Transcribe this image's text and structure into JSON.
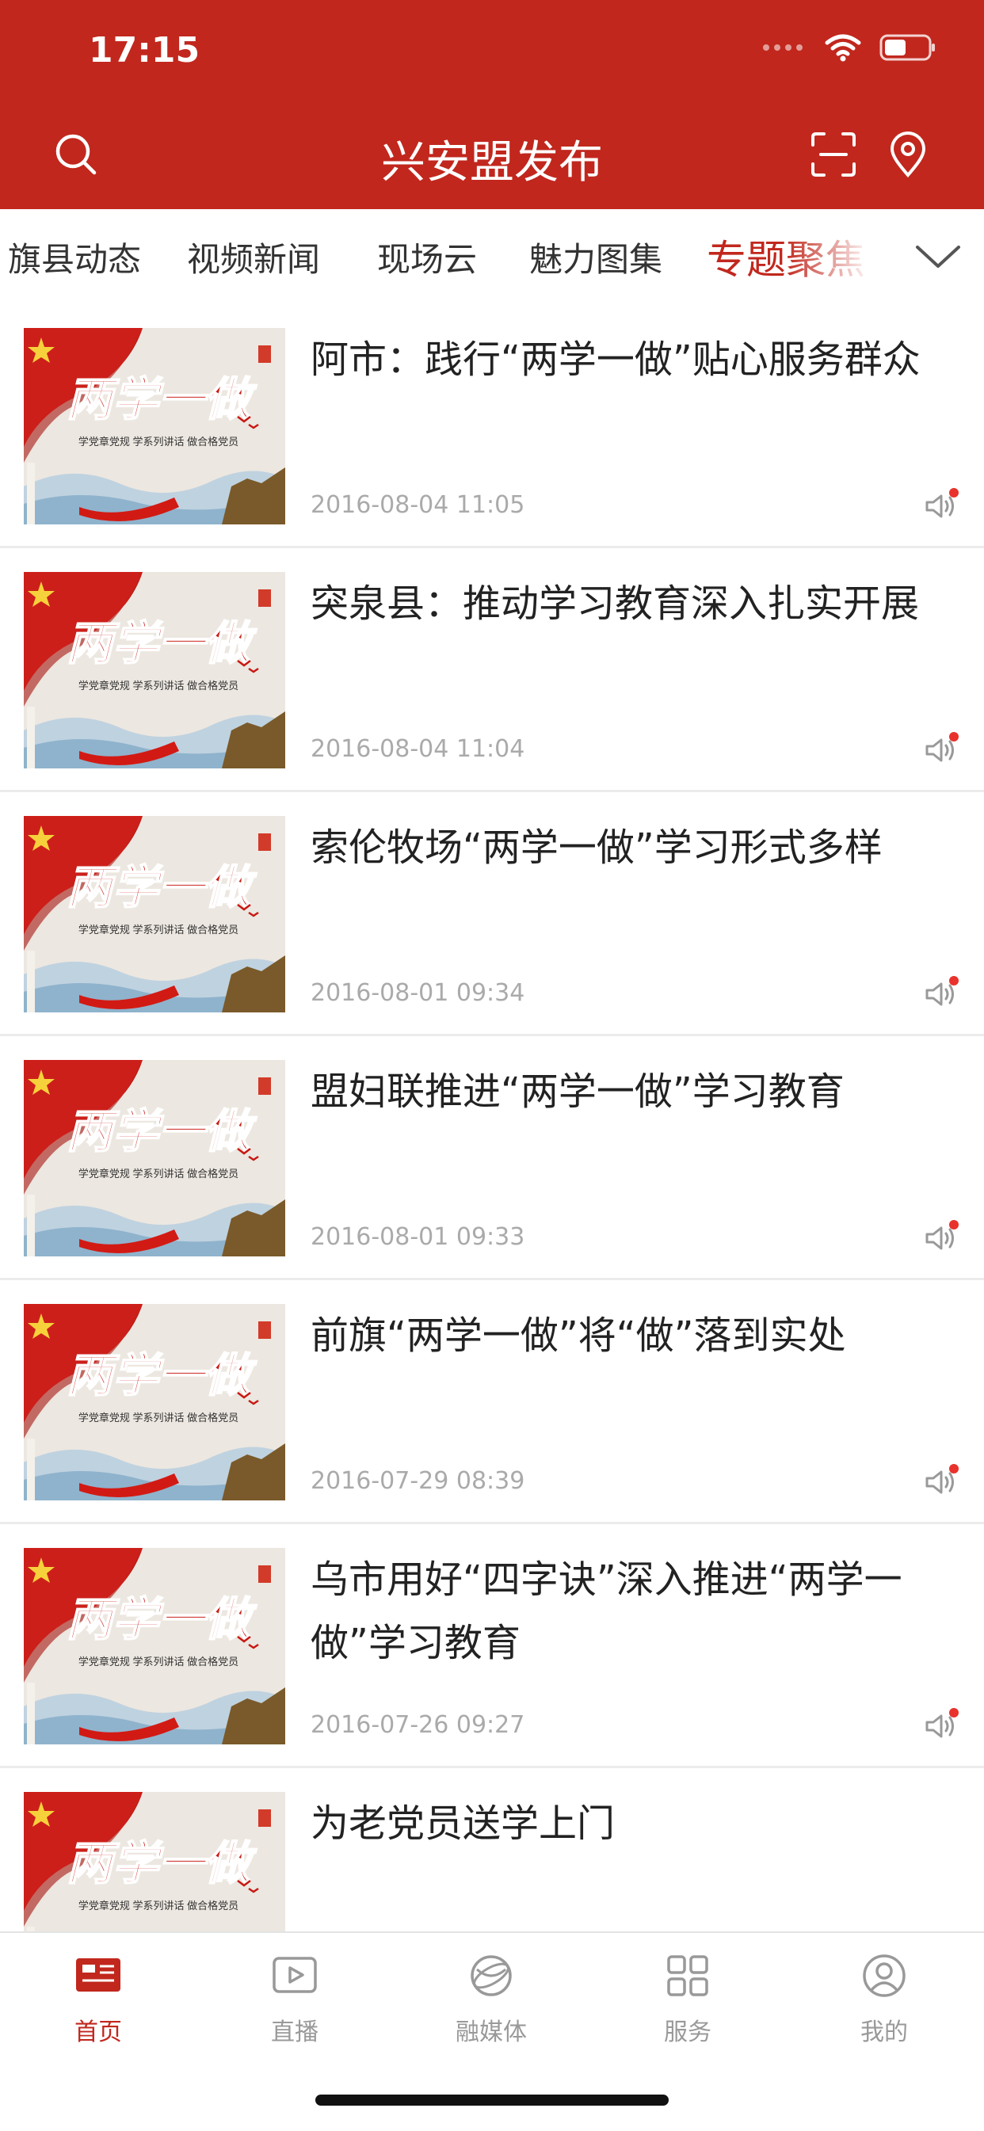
{
  "status_bar": {
    "time": "17:15"
  },
  "header": {
    "title": "兴安盟发布"
  },
  "tabs": [
    {
      "label": "旗县动态",
      "active": false
    },
    {
      "label": "视频新闻",
      "active": false
    },
    {
      "label": "现场云",
      "active": false
    },
    {
      "label": "魅力图集",
      "active": false
    },
    {
      "label": "专题聚焦",
      "active": true
    }
  ],
  "thumbnail": {
    "headline": "两学一做",
    "subline": "学党章党规 学系列讲话 做合格党员"
  },
  "articles": [
    {
      "title": "阿市：践行“两学一做”贴心服务群众",
      "date": "2016-08-04 11:05"
    },
    {
      "title": "突泉县：推动学习教育深入扎实开展",
      "date": "2016-08-04 11:04"
    },
    {
      "title": "索伦牧场“两学一做”学习形式多样",
      "date": "2016-08-01 09:34"
    },
    {
      "title": "盟妇联推进“两学一做”学习教育",
      "date": "2016-08-01 09:33"
    },
    {
      "title": "前旗“两学一做”将“做”落到实处",
      "date": "2016-07-29 08:39"
    },
    {
      "title": "乌市用好“四字诀”深入推进“两学一做”学习教育",
      "date": "2016-07-26 09:27"
    },
    {
      "title": "为老党员送学上门",
      "date": ""
    }
  ],
  "tabbar": [
    {
      "label": "首页",
      "icon": "news-icon",
      "active": true
    },
    {
      "label": "直播",
      "icon": "play-icon",
      "active": false
    },
    {
      "label": "融媒体",
      "icon": "globe-icon",
      "active": false
    },
    {
      "label": "服务",
      "icon": "grid-icon",
      "active": false
    },
    {
      "label": "我的",
      "icon": "user-icon",
      "active": false
    }
  ],
  "colors": {
    "brand_red": "#c1271d",
    "date_gray": "#aaaaaa",
    "badge_red": "#e8322b"
  }
}
